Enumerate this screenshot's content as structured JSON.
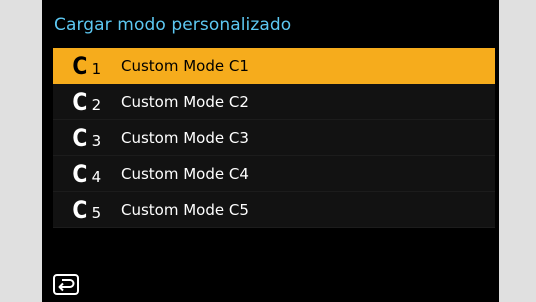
{
  "menu": {
    "title": "Cargar modo personalizado",
    "items": [
      {
        "icon_letter": "C",
        "number": "1",
        "label": "Custom Mode C1",
        "selected": true
      },
      {
        "icon_letter": "C",
        "number": "2",
        "label": "Custom Mode C2",
        "selected": false
      },
      {
        "icon_letter": "C",
        "number": "3",
        "label": "Custom Mode C3",
        "selected": false
      },
      {
        "icon_letter": "C",
        "number": "4",
        "label": "Custom Mode C4",
        "selected": false
      },
      {
        "icon_letter": "C",
        "number": "5",
        "label": "Custom Mode C5",
        "selected": false
      }
    ]
  },
  "footer": {
    "back_icon": "return-arrow-icon"
  },
  "colors": {
    "accent_selected": "#f6ac1c",
    "title_text": "#5dc8f2",
    "screen_background": "#000000",
    "outer_background": "#e0e0e0"
  }
}
